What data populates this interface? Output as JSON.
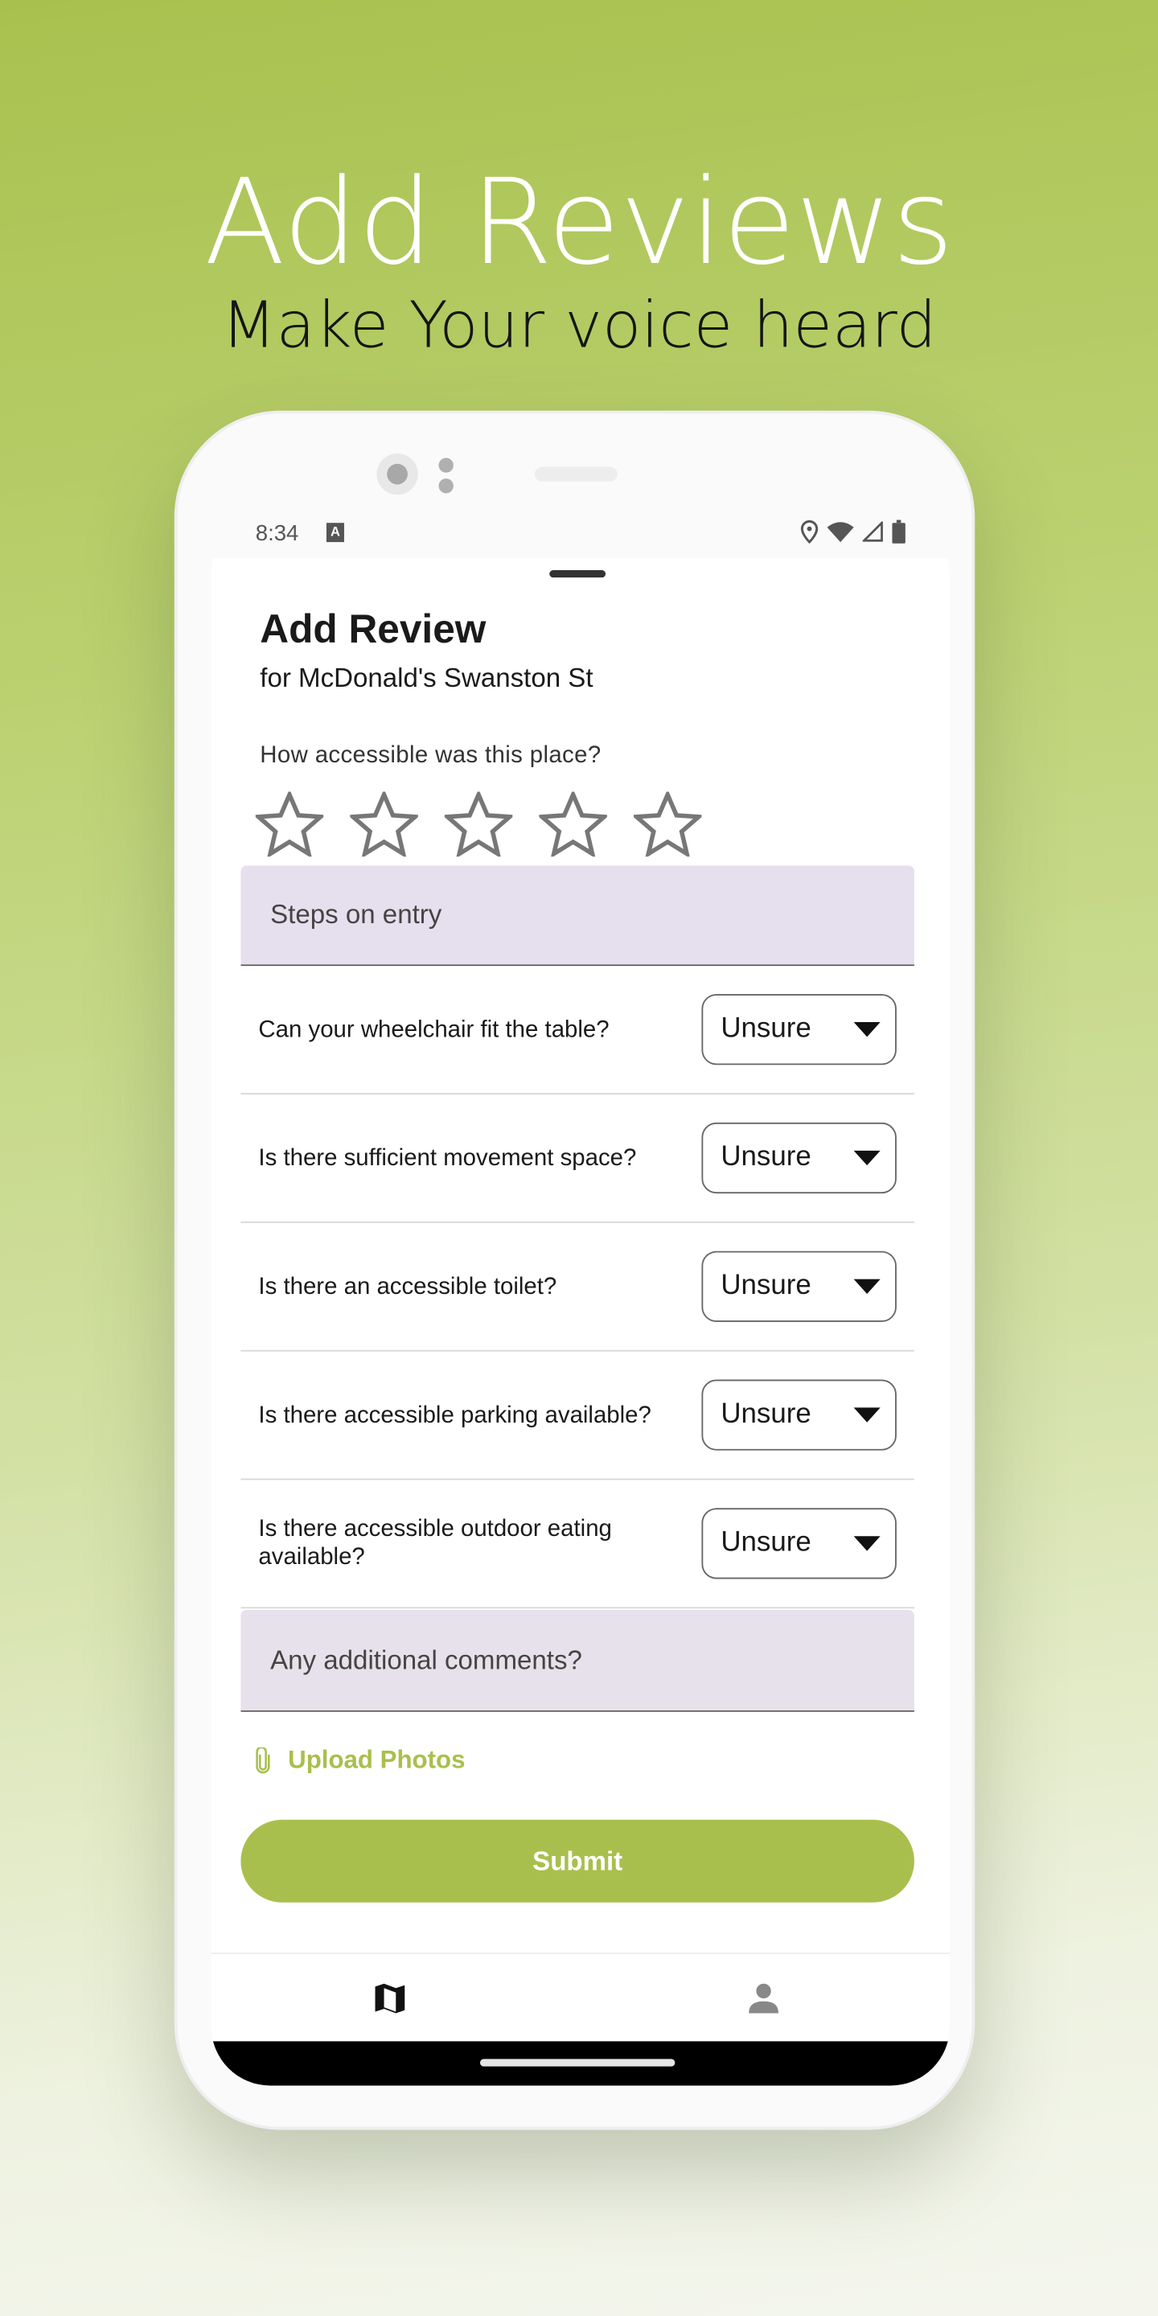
{
  "hero": {
    "title": "Add Reviews",
    "subtitle": "Make Your voice heard"
  },
  "status_bar": {
    "time": "8:34",
    "icons": [
      "accessibility-a-icon",
      "location-icon",
      "wifi-icon",
      "signal-icon",
      "battery-icon"
    ],
    "badge": "A"
  },
  "review": {
    "title": "Add Review",
    "subtitle": "for McDonald's Swanston St",
    "rating_question": "How accessible was this place?",
    "rating": 0,
    "max_rating": 5,
    "steps_placeholder": "Steps on entry",
    "questions": [
      {
        "label": "Can your wheelchair fit the table?",
        "value": "Unsure"
      },
      {
        "label": "Is there sufficient movement space?",
        "value": "Unsure"
      },
      {
        "label": "Is there an accessible toilet?",
        "value": "Unsure"
      },
      {
        "label": "Is there accessible parking available?",
        "value": "Unsure"
      },
      {
        "label": "Is there accessible outdoor eating available?",
        "value": "Unsure"
      }
    ],
    "comments_placeholder": "Any additional comments?",
    "upload_label": "Upload Photos",
    "submit_label": "Submit"
  },
  "bottom_nav": {
    "items": [
      {
        "icon": "map-icon",
        "active": true
      },
      {
        "icon": "person-icon",
        "active": false
      }
    ]
  },
  "colors": {
    "accent": "#a9bf4d",
    "field_bg": "#e6dfee"
  }
}
